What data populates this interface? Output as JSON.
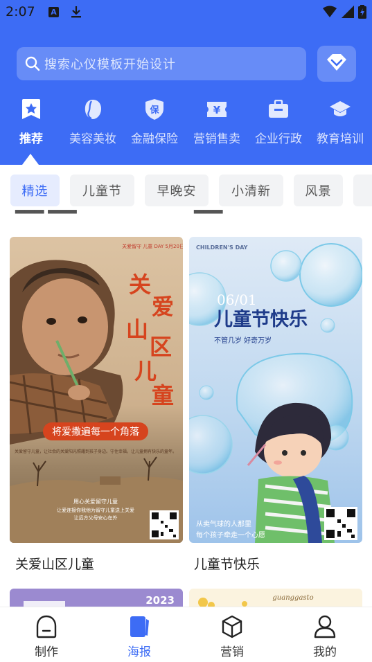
{
  "status_bar": {
    "time": "2:07",
    "notif_letter": "A"
  },
  "search": {
    "placeholder": "搜索心仪模板开始设计"
  },
  "categories": [
    {
      "label": "推荐",
      "icon": "star-bookmark-icon"
    },
    {
      "label": "美容美妆",
      "icon": "face-icon"
    },
    {
      "label": "金融保险",
      "icon": "insurance-shield-icon",
      "glyph": "保"
    },
    {
      "label": "营销售卖",
      "icon": "yen-coupon-icon",
      "glyph": "¥"
    },
    {
      "label": "企业行政",
      "icon": "briefcase-icon"
    },
    {
      "label": "教育培训",
      "icon": "graduation-cap-icon"
    }
  ],
  "chips": [
    "精选",
    "儿童节",
    "早晚安",
    "小清新",
    "风景"
  ],
  "cards": [
    {
      "title": "关爱山区儿童",
      "poster": {
        "top_small": "关爱留守 儿童 DAY 5月20日",
        "headline": [
          "关",
          "爱",
          "山",
          "区",
          "儿",
          "童"
        ],
        "banner": "将爱撒遍每一个角落",
        "body": "关爱留守儿童，让社会的关爱阳光照耀到孩子身边。守住幸福，让儿童拥有快乐的童年。",
        "footer": [
          "用心关爱留守儿童",
          "让爱连接你我他为留守儿童送上关爱",
          "让远方父母安心在外"
        ]
      }
    },
    {
      "title": "儿童节快乐",
      "poster": {
        "corner": "CHILDREN'S DAY",
        "date": "06/01",
        "headline": "儿童节快乐",
        "sub": "不管几岁  好奇万岁",
        "footer": [
          "从卖气球的人那里",
          "每个孩子牵走一个心愿"
        ]
      }
    }
  ],
  "bottom_peek": {
    "left_year": "2023",
    "right_script": "guanggasto"
  },
  "tabbar": [
    {
      "label": "制作",
      "icon": "make-icon"
    },
    {
      "label": "海报",
      "icon": "poster-icon"
    },
    {
      "label": "营销",
      "icon": "box-icon"
    },
    {
      "label": "我的",
      "icon": "user-icon"
    }
  ],
  "colors": {
    "primary": "#3d6cf5",
    "chip_active_bg": "#e6ecfe"
  }
}
